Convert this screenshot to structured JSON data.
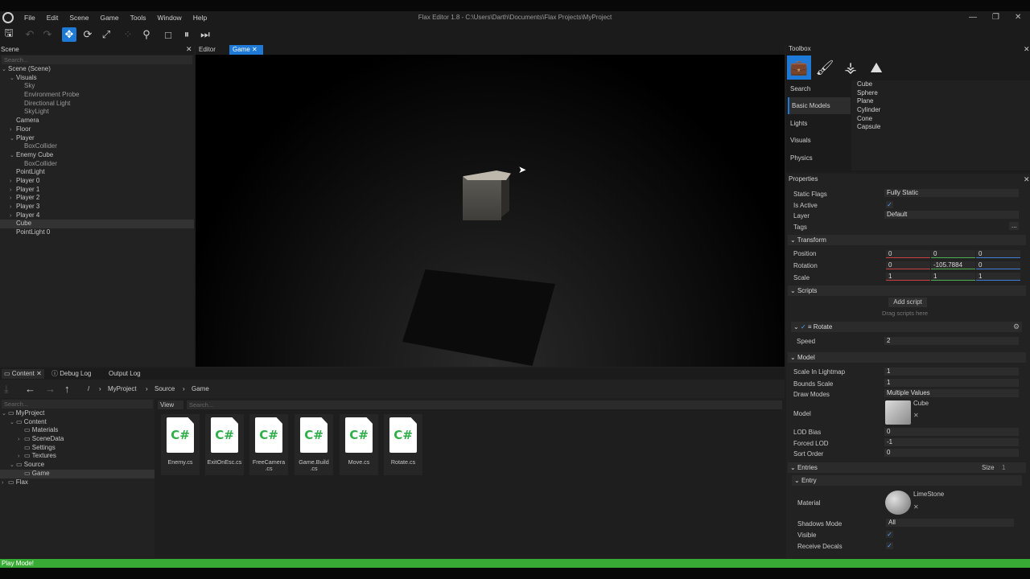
{
  "window": {
    "title": "Flax Editor 1.8 - C:\\Users\\Darth\\Documents\\Flax Projects\\MyProject"
  },
  "menu": [
    "File",
    "Edit",
    "Scene",
    "Game",
    "Tools",
    "Window",
    "Help"
  ],
  "scene_panel": {
    "title": "Scene",
    "search_placeholder": "Search...",
    "items": [
      {
        "label": "Scene (Scene)",
        "indent": 0,
        "expand": "open"
      },
      {
        "label": "Visuals",
        "indent": 1,
        "expand": "open"
      },
      {
        "label": "Sky",
        "indent": 2,
        "grey": true
      },
      {
        "label": "Environment Probe",
        "indent": 2,
        "grey": true
      },
      {
        "label": "Directional Light",
        "indent": 2,
        "grey": true
      },
      {
        "label": "SkyLight",
        "indent": 2,
        "grey": true
      },
      {
        "label": "Camera",
        "indent": 1
      },
      {
        "label": "Floor",
        "indent": 1,
        "expand": "closed"
      },
      {
        "label": "Player",
        "indent": 1,
        "expand": "open"
      },
      {
        "label": "BoxCollider",
        "indent": 2,
        "grey": true
      },
      {
        "label": "Enemy Cube",
        "indent": 1,
        "expand": "open"
      },
      {
        "label": "BoxCollider",
        "indent": 2,
        "grey": true
      },
      {
        "label": "PointLight",
        "indent": 1
      },
      {
        "label": "Player 0",
        "indent": 1,
        "expand": "closed"
      },
      {
        "label": "Player 1",
        "indent": 1,
        "expand": "closed"
      },
      {
        "label": "Player 2",
        "indent": 1,
        "expand": "closed"
      },
      {
        "label": "Player 3",
        "indent": 1,
        "expand": "closed"
      },
      {
        "label": "Player 4",
        "indent": 1,
        "expand": "closed"
      },
      {
        "label": "Cube",
        "indent": 1,
        "selected": true
      },
      {
        "label": "PointLight 0",
        "indent": 1
      }
    ]
  },
  "viewport_tabs": {
    "editor": "Editor",
    "game": "Game"
  },
  "content_tabs": {
    "content": "Content",
    "debug_log": "Debug Log",
    "output_log": "Output Log"
  },
  "breadcrumb": [
    "/",
    "MyProject",
    "Source",
    "Game"
  ],
  "content_tree": {
    "search_placeholder": "Search...",
    "items": [
      {
        "label": "MyProject",
        "indent": 0,
        "expand": "open"
      },
      {
        "label": "Content",
        "indent": 1,
        "expand": "open"
      },
      {
        "label": "Materials",
        "indent": 2
      },
      {
        "label": "SceneData",
        "indent": 2,
        "expand": "closed"
      },
      {
        "label": "Settings",
        "indent": 2
      },
      {
        "label": "Textures",
        "indent": 2,
        "expand": "closed"
      },
      {
        "label": "Source",
        "indent": 1,
        "expand": "open"
      },
      {
        "label": "Game",
        "indent": 2,
        "selected": true
      },
      {
        "label": "Flax",
        "indent": 0,
        "expand": "closed"
      }
    ]
  },
  "content_view": {
    "view_label": "View",
    "search_placeholder": "Search...",
    "files": [
      {
        "icon_text": "C#",
        "name": "Enemy.cs"
      },
      {
        "icon_text": "C#",
        "name": "ExitOnEsc.cs"
      },
      {
        "icon_text": "C#",
        "name": "FreeCamera\n.cs"
      },
      {
        "icon_text": "C#",
        "name": "Game.Build\n.cs"
      },
      {
        "icon_text": "C#",
        "name": "Move.cs"
      },
      {
        "icon_text": "C#",
        "name": "Rotate.cs"
      }
    ]
  },
  "toolbox": {
    "title": "Toolbox",
    "categories": [
      "Search",
      "Basic Models",
      "Lights",
      "Visuals",
      "Physics"
    ],
    "items": [
      "Cube",
      "Sphere",
      "Plane",
      "Cylinder",
      "Cone",
      "Capsule"
    ]
  },
  "properties": {
    "title": "Properties",
    "static_flags": {
      "label": "Static Flags",
      "value": "Fully Static"
    },
    "is_active": {
      "label": "Is Active"
    },
    "layer": {
      "label": "Layer",
      "value": "Default"
    },
    "tags": {
      "label": "Tags",
      "button": "..."
    },
    "transform": {
      "title": "Transform",
      "position": {
        "label": "Position",
        "x": "0",
        "y": "0",
        "z": "0"
      },
      "rotation": {
        "label": "Rotation",
        "x": "0",
        "y": "-105.7884",
        "z": "0"
      },
      "scale": {
        "label": "Scale",
        "x": "1",
        "y": "1",
        "z": "1"
      }
    },
    "scripts": {
      "title": "Scripts",
      "add_button": "Add script",
      "hint": "Drag scripts here",
      "rotate": {
        "title": "Rotate",
        "speed_label": "Speed",
        "speed_value": "2"
      }
    },
    "model": {
      "title": "Model",
      "scale_in_lightmap": {
        "label": "Scale In Lightmap",
        "value": "1"
      },
      "bounds_scale": {
        "label": "Bounds Scale",
        "value": "1"
      },
      "draw_modes": {
        "label": "Draw Modes",
        "value": "Multiple Values"
      },
      "model": {
        "label": "Model",
        "asset": "Cube"
      },
      "lod_bias": {
        "label": "LOD Bias",
        "value": "0"
      },
      "forced_lod": {
        "label": "Forced LOD",
        "value": "-1"
      },
      "sort_order": {
        "label": "Sort Order",
        "value": "0"
      }
    },
    "entries": {
      "title": "Entries",
      "size_label": "Size",
      "size_value": "1",
      "entry": {
        "title": "Entry",
        "material_label": "Material",
        "material_asset": "LimeStone",
        "shadows_mode": {
          "label": "Shadows Mode",
          "value": "All"
        },
        "visible": {
          "label": "Visible"
        },
        "receive_decals": {
          "label": "Receive Decals"
        }
      }
    }
  },
  "status": "Play Mode!",
  "colors": {
    "accent": "#1e7ad6",
    "status_bar": "#39a935",
    "csharp_icon": "#2fae4a"
  }
}
